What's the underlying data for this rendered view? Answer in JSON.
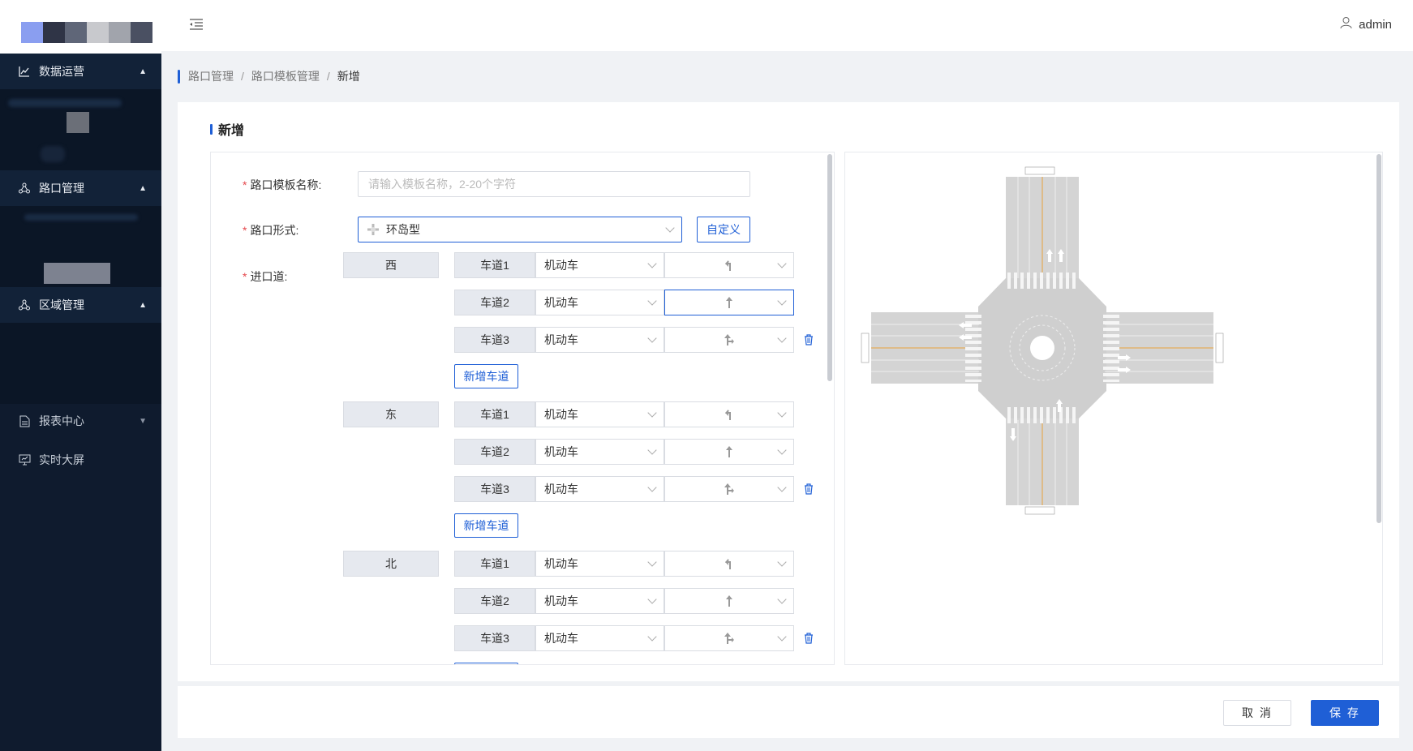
{
  "sidebar": {
    "groups": [
      {
        "label": "数据运营"
      },
      {
        "label": "路口管理"
      },
      {
        "label": "区域管理"
      }
    ],
    "plain": [
      {
        "label": "报表中心"
      },
      {
        "label": "实时大屏"
      }
    ]
  },
  "header": {
    "username": "admin"
  },
  "breadcrumb": {
    "items": [
      "路口管理",
      "路口模板管理",
      "新增"
    ]
  },
  "form": {
    "title": "新增",
    "name_label": "路口模板名称:",
    "name_placeholder": "请输入模板名称，2-20个字符",
    "shape_label": "路口形式:",
    "shape_value": "环岛型",
    "custom_button": "自定义",
    "approach_label": "进口道:",
    "add_lane_label": "新增车道",
    "approaches": [
      {
        "direction": "西",
        "lanes": [
          {
            "name": "车道1",
            "type": "机动车",
            "turn": "left-turn"
          },
          {
            "name": "车道2",
            "type": "机动车",
            "turn": "straight"
          },
          {
            "name": "车道3",
            "type": "机动车",
            "turn": "straight-right"
          }
        ]
      },
      {
        "direction": "东",
        "lanes": [
          {
            "name": "车道1",
            "type": "机动车",
            "turn": "left-turn"
          },
          {
            "name": "车道2",
            "type": "机动车",
            "turn": "straight"
          },
          {
            "name": "车道3",
            "type": "机动车",
            "turn": "straight-right"
          }
        ]
      },
      {
        "direction": "北",
        "lanes": [
          {
            "name": "车道1",
            "type": "机动车",
            "turn": "left-turn"
          },
          {
            "name": "车道2",
            "type": "机动车",
            "turn": "straight"
          },
          {
            "name": "车道3",
            "type": "机动车",
            "turn": "straight-right"
          }
        ]
      }
    ]
  },
  "footer": {
    "cancel": "取 消",
    "save": "保 存"
  },
  "colors": {
    "accent": "#1f5fd6",
    "sidebar": "#0f1b2e",
    "required": "#e5484d"
  }
}
